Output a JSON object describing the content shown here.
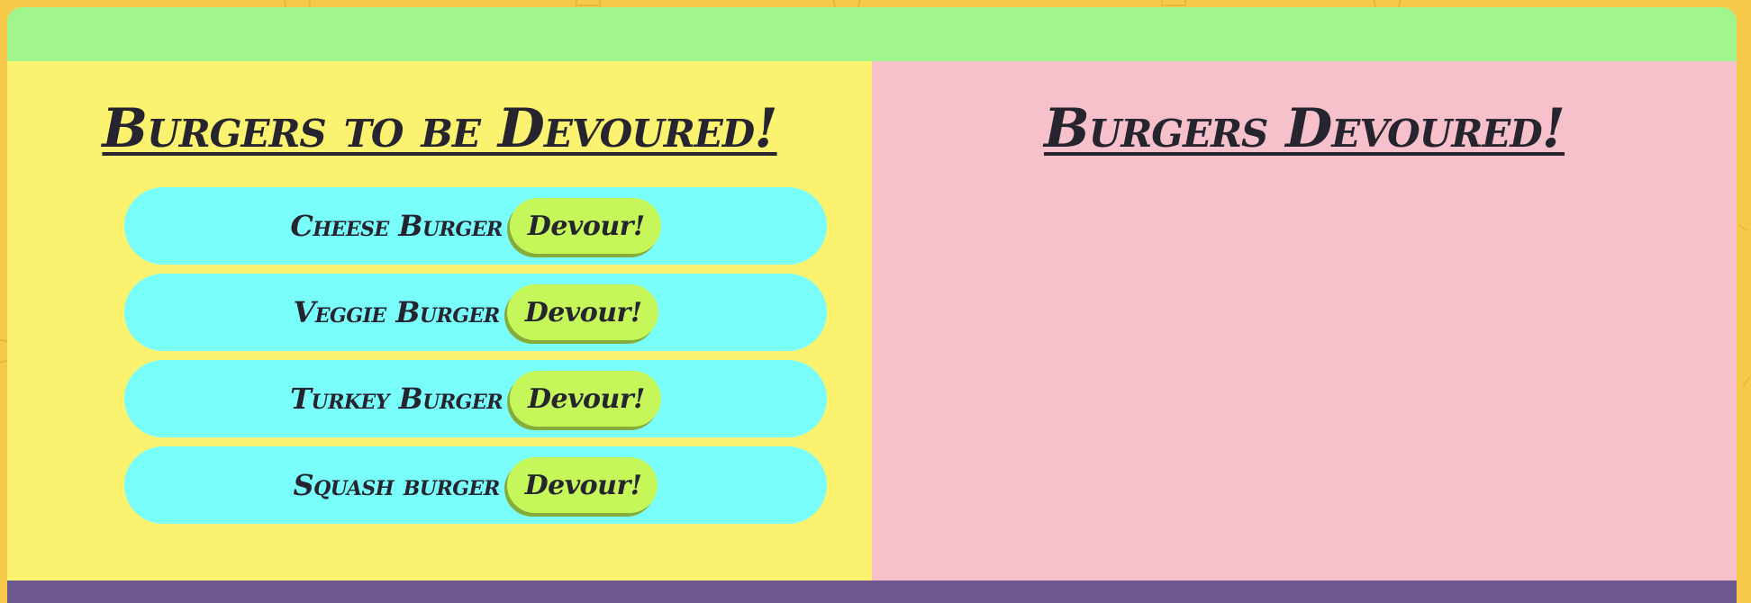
{
  "colors": {
    "page_background": "#f7c94a",
    "header_bar": "#a0f58c",
    "left_column": "#fbf36f",
    "right_column": "#f6c1cb",
    "burger_item": "#79fdfb",
    "devour_button": "#c5f75a",
    "devour_button_shadow": "#86ad3c",
    "footer_bar": "#6f5790",
    "text": "#25242f"
  },
  "left_column": {
    "title": "Burgers to be Devoured!",
    "burgers": [
      {
        "name": "Cheese Burger",
        "button_label": "Devour!"
      },
      {
        "name": "Veggie Burger",
        "button_label": "Devour!"
      },
      {
        "name": "Turkey Burger",
        "button_label": "Devour!"
      },
      {
        "name": "Squash burger",
        "button_label": "Devour!"
      }
    ]
  },
  "right_column": {
    "title": "Burgers Devoured!"
  }
}
